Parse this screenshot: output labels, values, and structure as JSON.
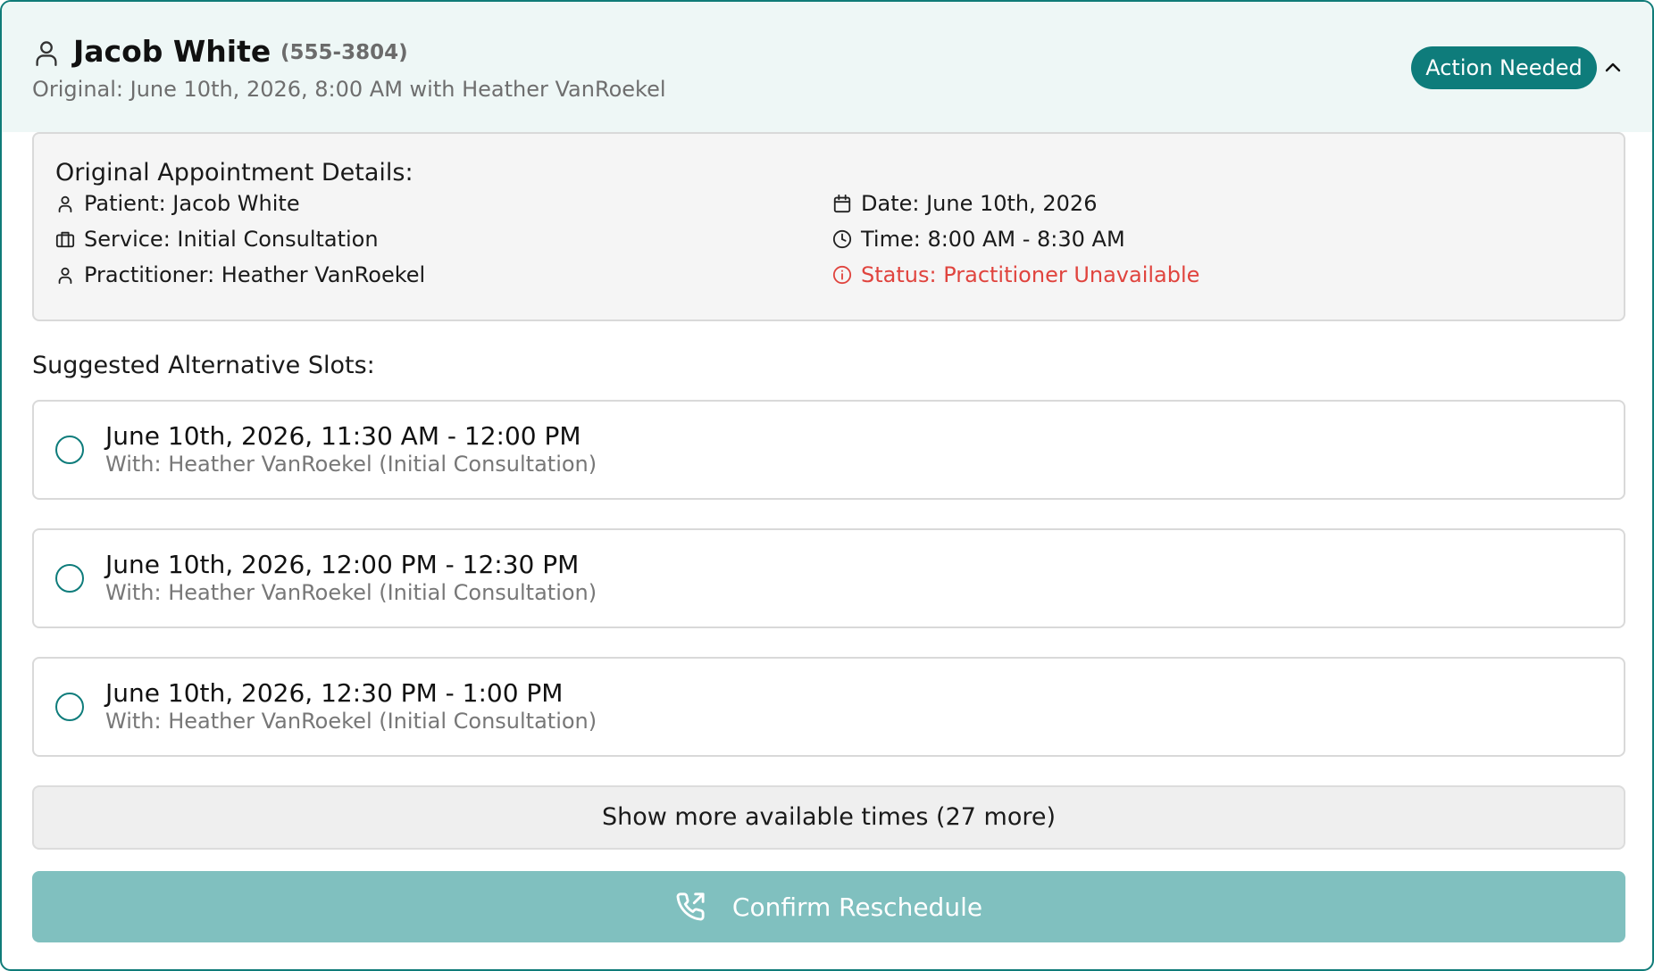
{
  "header": {
    "name": "Jacob White",
    "phone": "(555-3804)",
    "original": "Original: June 10th, 2026, 8:00 AM with Heather VanRoekel",
    "badge": "Action Needed"
  },
  "details": {
    "title": "Original Appointment Details:",
    "patient": "Patient: Jacob White",
    "service": "Service: Initial Consultation",
    "practitioner": "Practitioner: Heather VanRoekel",
    "date": "Date: June 10th, 2026",
    "time": "Time: 8:00 AM - 8:30 AM",
    "status": "Status: Practitioner Unavailable"
  },
  "suggestions": {
    "title": "Suggested Alternative Slots:",
    "slots": [
      {
        "time": "June 10th, 2026, 11:30 AM - 12:00 PM",
        "with": "With: Heather VanRoekel (Initial Consultation)"
      },
      {
        "time": "June 10th, 2026, 12:00 PM - 12:30 PM",
        "with": "With: Heather VanRoekel (Initial Consultation)"
      },
      {
        "time": "June 10th, 2026, 12:30 PM - 1:00 PM",
        "with": "With: Heather VanRoekel (Initial Consultation)"
      }
    ],
    "show_more": "Show more available times (27 more)"
  },
  "actions": {
    "confirm": "Confirm Reschedule"
  },
  "colors": {
    "accent": "#0e7c7b",
    "confirm_disabled": "#80c0bf",
    "status_red": "#e0443e"
  },
  "icons": {
    "header": "user-icon",
    "collapse": "chevron-up-icon",
    "patient": "user-icon",
    "service": "briefcase-icon",
    "practitioner": "user-icon",
    "date": "calendar-icon",
    "time": "clock-icon",
    "status": "info-icon",
    "confirm": "phone-forward-icon"
  }
}
